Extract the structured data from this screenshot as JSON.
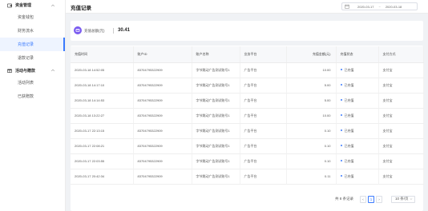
{
  "sidebar": {
    "groups": [
      {
        "label": "资金管理",
        "icon": "wallet-icon",
        "items": [
          {
            "label": "资金钱包",
            "active": false
          },
          {
            "label": "财务流水",
            "active": false
          },
          {
            "label": "充值记录",
            "active": true
          },
          {
            "label": "退款记录",
            "active": false
          }
        ]
      },
      {
        "label": "活动与赠款",
        "icon": "gift-icon",
        "items": [
          {
            "label": "活动列表",
            "active": false
          },
          {
            "label": "已获赠款",
            "active": false
          }
        ]
      }
    ]
  },
  "header": {
    "title": "充值记录",
    "date_start": "2020-03-17",
    "date_sep": "~",
    "date_end": "2020-03-18"
  },
  "summary": {
    "label": "充值总额(元)",
    "value": "30.41"
  },
  "table": {
    "columns": [
      "充值时间",
      "账户ID",
      "账户名称",
      "业务平台",
      "充值金额(元)",
      "充值状态",
      "支付方式"
    ],
    "rows": [
      {
        "time": "2020-03-18 14:52:05",
        "account_id": "83704795322909",
        "name": "字节跳动广告测试账号1",
        "platform": "广告平台",
        "amount": "10.00",
        "status": "已充值",
        "pay": "支付宝"
      },
      {
        "time": "2020-03-18 14:17:10",
        "account_id": "83704795322909",
        "name": "字节跳动广告测试账号1",
        "platform": "广告平台",
        "amount": "5.00",
        "status": "已充值",
        "pay": "支付宝"
      },
      {
        "time": "2020-03-18 14:14:53",
        "account_id": "83704795322909",
        "name": "字节跳动广告测试账号1",
        "platform": "广告平台",
        "amount": "5.00",
        "status": "已充值",
        "pay": "支付宝"
      },
      {
        "time": "2020-03-18 13:22:27",
        "account_id": "83704795322909",
        "name": "字节跳动广告测试账号1",
        "platform": "广告平台",
        "amount": "10.00",
        "status": "已充值",
        "pay": "支付宝"
      },
      {
        "time": "2020-03-17 22:13:15",
        "account_id": "83704795322909",
        "name": "字节跳动广告测试账号1",
        "platform": "广告平台",
        "amount": "0.10",
        "status": "已充值",
        "pay": "支付宝"
      },
      {
        "time": "2020-03-17 22:08:21",
        "account_id": "83704795322909",
        "name": "字节跳动广告测试账号1",
        "platform": "广告平台",
        "amount": "0.10",
        "status": "已充值",
        "pay": "支付宝"
      },
      {
        "time": "2020-03-17 22:03:55",
        "account_id": "83704795322909",
        "name": "字节跳动广告测试账号1",
        "platform": "广告平台",
        "amount": "0.10",
        "status": "已充值",
        "pay": "支付宝"
      },
      {
        "time": "2020-03-17 20:42:34",
        "account_id": "83704795322909",
        "name": "字节跳动广告测试账号1",
        "platform": "广告平台",
        "amount": "0.11",
        "status": "已充值",
        "pay": "支付宝"
      }
    ]
  },
  "pagination": {
    "total": "共 8 条记录",
    "prev": "‹",
    "current_page": "1",
    "next": "›",
    "page_size": "10 条/页"
  },
  "colors": {
    "accent": "#3a7afe",
    "summary_icon": "#7b5cf0"
  }
}
